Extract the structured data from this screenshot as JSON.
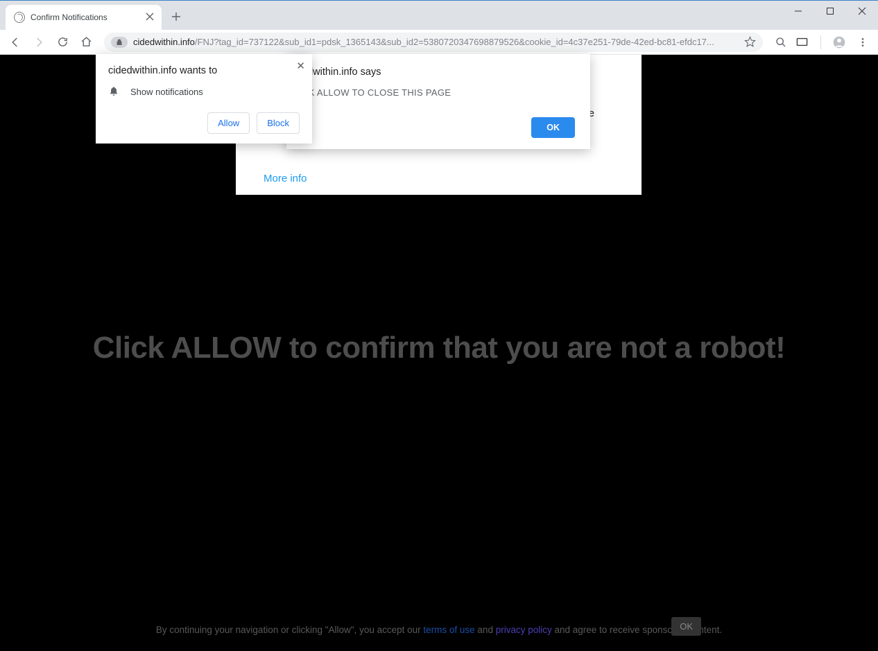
{
  "window": {
    "tab_title": "Confirm Notifications",
    "url_host": "cidedwithin.info",
    "url_path": "/FNJ?tag_id=737122&sub_id1=pdsk_1365143&sub_id2=5380720347698879526&cookie_id=4c37e251-79de-42ed-bc81-efdc17..."
  },
  "perm_popup": {
    "title": "cidedwithin.info wants to",
    "text": "Show notifications",
    "allow": "Allow",
    "block": "Block"
  },
  "js_alert": {
    "title_suffix": "edwithin.info says",
    "body_suffix": "CK ALLOW TO CLOSE THIS PAGE",
    "ok": "OK"
  },
  "card": {
    "partial": "ue",
    "more_info": "More info"
  },
  "page": {
    "headline": "Click ALLOW to confirm that you are not a robot!",
    "footer_1": "By continuing your navigation or clicking \"Allow\", you accept our ",
    "footer_link_terms": "terms of use",
    "footer_and": " and ",
    "footer_link_privacy": "privacy policy",
    "footer_2": " and agree to receive sponsored content.",
    "footer_ok": "OK"
  }
}
